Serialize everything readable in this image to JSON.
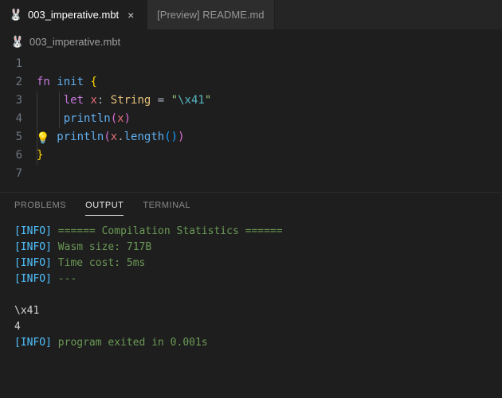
{
  "tabs": [
    {
      "icon": "🐰",
      "label": "003_imperative.mbt",
      "active": true,
      "closeable": true
    },
    {
      "icon": "",
      "label": "[Preview] README.md",
      "active": false,
      "closeable": false
    }
  ],
  "breadcrumb": {
    "icon": "🐰",
    "file": "003_imperative.mbt"
  },
  "code": {
    "lines": [
      1,
      2,
      3,
      4,
      5,
      6,
      7
    ],
    "kw_fn": "fn",
    "fn_name": "init",
    "brace_open": "{",
    "kw_let": "let",
    "var_x": "x",
    "colon": ":",
    "type_string": "String",
    "eq": "=",
    "str_quote": "\"",
    "str_esc": "\\x41",
    "fn_println": "println",
    "paren_open": "(",
    "paren_close": ")",
    "dot": ".",
    "method_length": "length",
    "inner_paren_open": "(",
    "inner_paren_close": ")",
    "brace_close": "}",
    "bulb": "💡"
  },
  "panel": {
    "tabs": {
      "problems": "PROBLEMS",
      "output": "OUTPUT",
      "terminal": "TERMINAL"
    },
    "active": "output"
  },
  "output": {
    "info_tag": "[INFO]",
    "line1": "====== Compilation Statistics ======",
    "line2": "Wasm size: 717B",
    "line3": "Time cost: 5ms",
    "line4": "---",
    "prog1": "\\x41",
    "prog2": "4",
    "exit": "program exited in 0.001s"
  }
}
